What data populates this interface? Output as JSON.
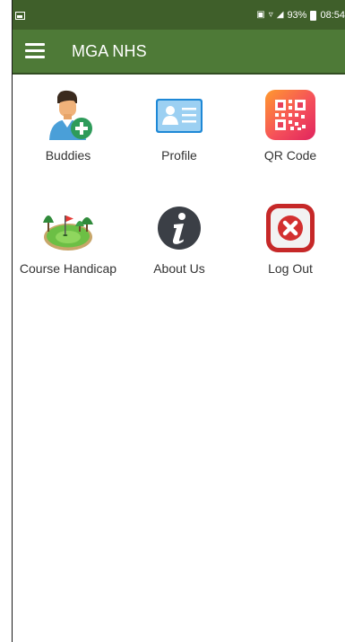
{
  "status_bar": {
    "battery_percent": "93%",
    "time": "08:54"
  },
  "app_bar": {
    "title": "MGA NHS",
    "menu_icon": "hamburger-menu-icon"
  },
  "menu_tiles": [
    {
      "label": "Buddies",
      "icon": "add-buddy-icon"
    },
    {
      "label": "Profile",
      "icon": "profile-card-icon"
    },
    {
      "label": "QR Code",
      "icon": "qr-code-icon"
    },
    {
      "label": "Course Handicap",
      "icon": "golf-course-icon"
    },
    {
      "label": "About Us",
      "icon": "info-icon"
    },
    {
      "label": "Log Out",
      "icon": "logout-icon"
    }
  ],
  "colors": {
    "status_bar": "#3f5f2a",
    "app_bar": "#4e7a37",
    "label_text": "#333333"
  }
}
